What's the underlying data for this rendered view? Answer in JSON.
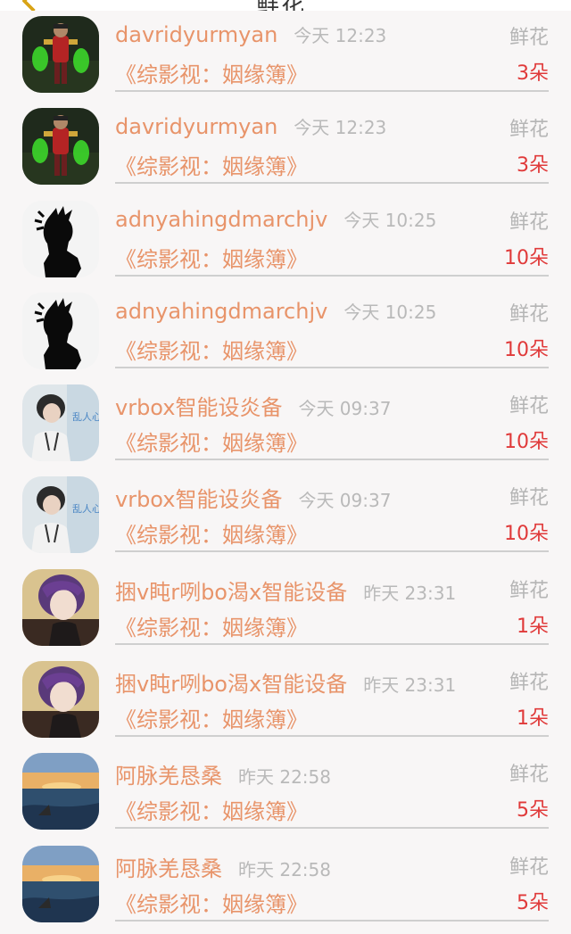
{
  "header": {
    "title": "鲜花"
  },
  "rows": [
    {
      "name": "davridyurmyan",
      "time": "今天 12:23",
      "gift_type": "鲜花",
      "book": "《综影视：姻缘簿》",
      "count": "3朵",
      "avatar": "armored-warrior"
    },
    {
      "name": "davridyurmyan",
      "time": "今天 12:23",
      "gift_type": "鲜花",
      "book": "《综影视：姻缘簿》",
      "count": "3朵",
      "avatar": "armored-warrior"
    },
    {
      "name": "adnyahingdmarchjv",
      "time": "今天 10:25",
      "gift_type": "鲜花",
      "book": "《综影视：姻缘簿》",
      "count": "10朵",
      "avatar": "silhouette"
    },
    {
      "name": "adnyahingdmarchjv",
      "time": "今天 10:25",
      "gift_type": "鲜花",
      "book": "《综影视：姻缘簿》",
      "count": "10朵",
      "avatar": "silhouette"
    },
    {
      "name": "vrbox智能设炎备",
      "time": "今天 09:37",
      "gift_type": "鲜花",
      "book": "《综影视：姻缘簿》",
      "count": "10朵",
      "avatar": "person-with-sign"
    },
    {
      "name": "vrbox智能设炎备",
      "time": "今天 09:37",
      "gift_type": "鲜花",
      "book": "《综影视：姻缘簿》",
      "count": "10朵",
      "avatar": "person-with-sign"
    },
    {
      "name": "捆v盹r咧bo渴x智能设备",
      "time": "昨天 23:31",
      "gift_type": "鲜花",
      "book": "《综影视：姻缘簿》",
      "count": "1朵",
      "avatar": "purple-hair-portrait"
    },
    {
      "name": "捆v盹r咧bo渴x智能设备",
      "time": "昨天 23:31",
      "gift_type": "鲜花",
      "book": "《综影视：姻缘簿》",
      "count": "1朵",
      "avatar": "purple-hair-portrait"
    },
    {
      "name": "阿脉羌恳桑",
      "time": "昨天 22:58",
      "gift_type": "鲜花",
      "book": "《综影视：姻缘簿》",
      "count": "5朵",
      "avatar": "sunset-seascape"
    },
    {
      "name": "阿脉羌恳桑",
      "time": "昨天 22:58",
      "gift_type": "鲜花",
      "book": "《综影视：姻缘簿》",
      "count": "5朵",
      "avatar": "sunset-seascape"
    }
  ],
  "colors": {
    "name": "#e8946a",
    "count": "#e03a3a",
    "muted": "#b5b5b5",
    "background": "#f8f6f6"
  }
}
